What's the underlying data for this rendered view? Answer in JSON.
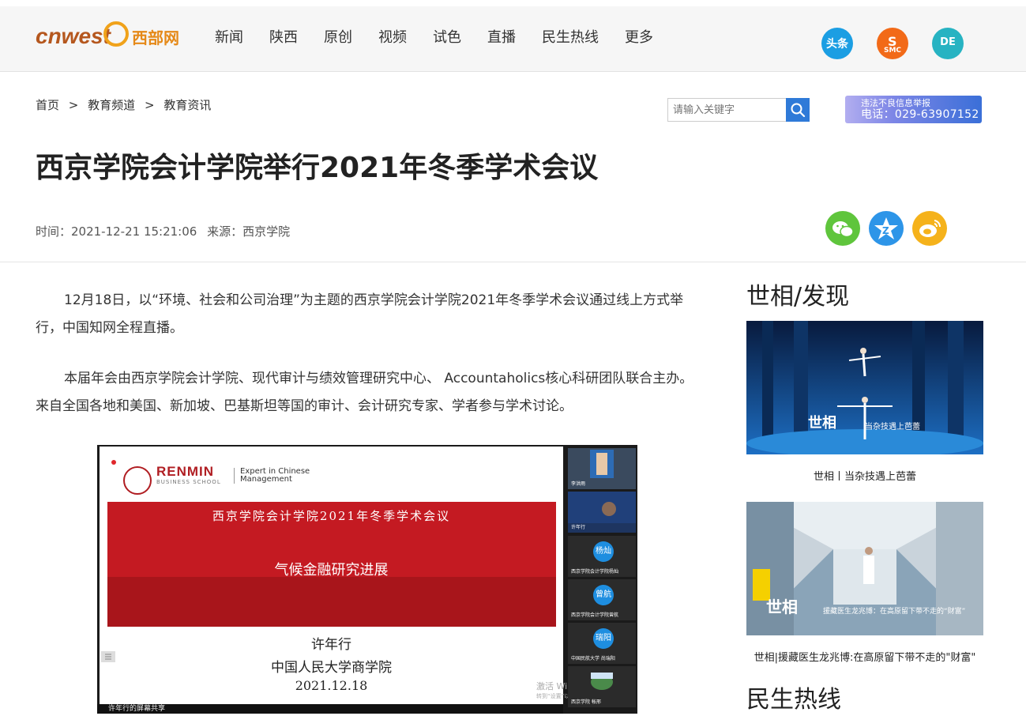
{
  "header": {
    "logo_text": "cnwest",
    "logo_cn": "西部网",
    "nav": [
      "新闻",
      "陕西",
      "原创",
      "视频",
      "试色",
      "直播",
      "民生热线",
      "更多"
    ],
    "apps": [
      {
        "icon": "toutiao-icon",
        "label": "头条",
        "color": "#1b9ee3"
      },
      {
        "icon": "smc-icon",
        "label": "SMC",
        "color": "#f26a18"
      },
      {
        "icon": "de-icon",
        "label": "DE",
        "color": "#27b3c2"
      }
    ]
  },
  "breadcrumb": [
    "首页",
    ">",
    "教育频道",
    ">",
    "教育资讯"
  ],
  "search": {
    "placeholder": "请输入关键字"
  },
  "report": {
    "line1": "违法不良信息举报",
    "line2": "电话：029-63907152"
  },
  "article": {
    "title": "西京学院会计学院举行2021年冬季学术会议",
    "time_label": "时间：2021-12-21 15:21:06",
    "source_label": "来源：西京学院",
    "paragraphs": [
      "12月18日，以“环境、社会和公司治理”为主题的西京学院会计学院2021年冬季学术会议通过线上方式举行，中国知网全程直播。",
      "本届年会由西京学院会计学院、现代审计与绩效管理研究中心、 Accountaholics核心科研团队联合主办。来自全国各地和美国、新加坡、巴基斯坦等国的审计、会计研究专家、学者参与学术讨论。"
    ]
  },
  "share": [
    {
      "icon": "wechat-icon",
      "color": "#5fc53c"
    },
    {
      "icon": "qzone-icon",
      "color": "#2d95e8"
    },
    {
      "icon": "weibo-icon",
      "color": "#f5b21b"
    }
  ],
  "video": {
    "school": "RENMIN",
    "school_sub": "BUSINESS SCHOOL",
    "tagline": "Expert in Chinese\nManagement",
    "conference": "西京学院会计学院2021年冬季学术会议",
    "topic": "气候金融研究进展",
    "speaker": "许年行",
    "affiliation": "中国人民大学商学院",
    "date": "2021.12.18",
    "watermark_line1": "激活 Windows",
    "watermark_line2": "转到“设置”以激活 Windows。",
    "share_status": "许年行的屏幕共享",
    "participants": [
      {
        "avatar": "",
        "name": "李洪雨"
      },
      {
        "avatar": "",
        "name": "许年行"
      },
      {
        "avatar": "杨灿",
        "name": "西京学院会计学院杨灿"
      },
      {
        "avatar": "曾航",
        "name": "西京学院会计学院曾航"
      },
      {
        "avatar": "瑞阳",
        "name": "中国民航大学 尚瑞阳"
      },
      {
        "avatar": "",
        "name": "西京学院 帐邢"
      }
    ]
  },
  "sidebar": {
    "section1": "世相/发现",
    "cards": [
      {
        "caption": "世相丨当杂技遇上芭蕾",
        "overlay": "当杂技遇上芭蕾",
        "brand": "世相"
      },
      {
        "caption": "世相|援藏医生龙兆博:在高原留下带不走的\"财富\"",
        "overlay": "援藏医生龙兆博：在高原留下带不走的“财富”",
        "brand": "世相"
      }
    ],
    "section2": "民生热线"
  }
}
